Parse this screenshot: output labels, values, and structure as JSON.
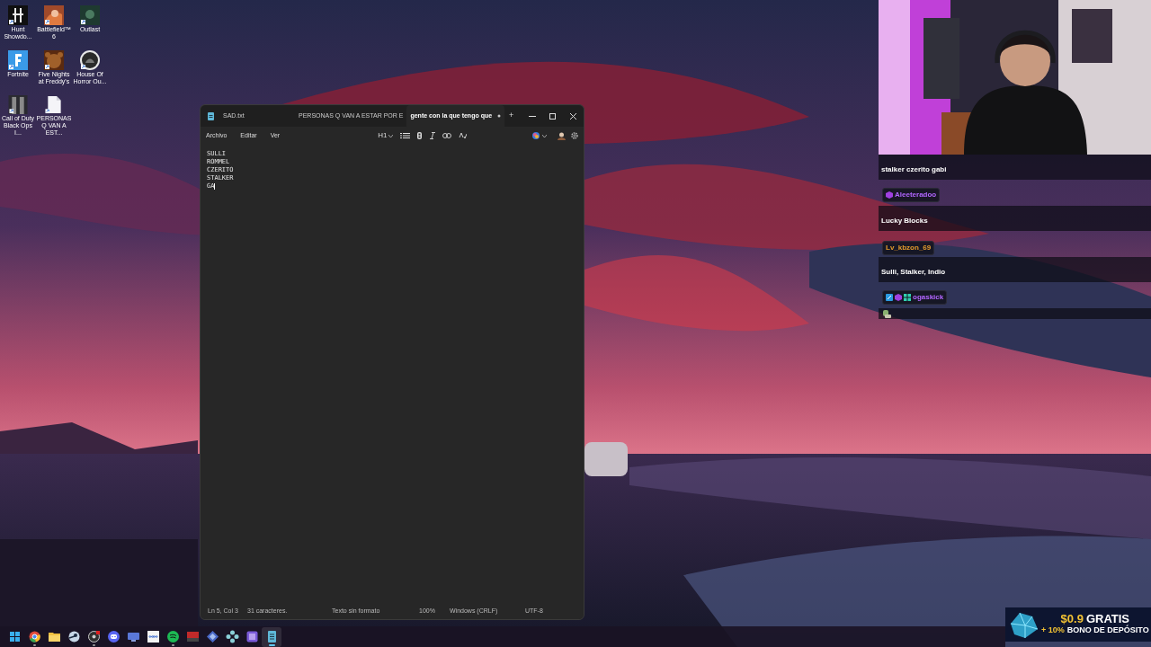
{
  "desktop_icons": [
    {
      "label": "Hunt Showdo...",
      "kind": "hunt"
    },
    {
      "label": "Battlefield™ 6",
      "kind": "battlefield"
    },
    {
      "label": "Outlast",
      "kind": "outlast"
    },
    {
      "label": "Fortnite",
      "kind": "fortnite"
    },
    {
      "label": "Five Nights at Freddy's",
      "kind": "fnaf"
    },
    {
      "label": "House Of Horror Ou...",
      "kind": "horror"
    },
    {
      "label": "Call of Duty Black Ops I...",
      "kind": "cod"
    },
    {
      "label": "PERSONAS Q VAN A EST...",
      "kind": "file"
    }
  ],
  "notepad": {
    "tabs": [
      {
        "title": "SAD.txt",
        "selected": false,
        "modified": false
      },
      {
        "title": "PERSONAS Q VAN A ESTAR POR E",
        "selected": false,
        "modified": false
      },
      {
        "title": "gente con la que tengo que",
        "selected": true,
        "modified": true
      }
    ],
    "new_tab": "+",
    "menu": [
      "Archivo",
      "Editar",
      "Ver"
    ],
    "heading_button": "H1",
    "lines": [
      "SULLI",
      "ROMMEL",
      "CZERITO",
      "STALKER",
      "GA"
    ],
    "status_bar": [
      "Ln 5, Col 3",
      "31 caracteres.",
      "Texto sin formato",
      "100%",
      "Windows (CRLF)",
      "UTF-8"
    ]
  },
  "chat": [
    {
      "kind": "message",
      "text": "stalker czerito gabi"
    },
    {
      "kind": "name_gem",
      "text": "Aleeteradoo",
      "color": "#b266ff"
    },
    {
      "kind": "message",
      "text": "Lucky Blocks"
    },
    {
      "kind": "name",
      "text": "Lv_kbzon_69",
      "color": "#e39a2c"
    },
    {
      "kind": "message",
      "text": "Sulli, Stalker, Indio"
    },
    {
      "kind": "name_multi",
      "text": "ogaskick",
      "color": "#b266ff"
    },
    {
      "kind": "emote"
    }
  ],
  "ad": {
    "price": "$0.9",
    "free": "GRATIS",
    "percent": "+ 10%",
    "bonus": "BONO DE DEPÓSITO"
  },
  "taskbar": [
    {
      "kind": "start",
      "running": false,
      "selected": false
    },
    {
      "kind": "chrome",
      "running": true,
      "selected": false
    },
    {
      "kind": "folder",
      "running": false,
      "selected": false
    },
    {
      "kind": "steam",
      "running": false,
      "selected": false
    },
    {
      "kind": "obs",
      "running": true,
      "selected": false
    },
    {
      "kind": "discord",
      "running": false,
      "selected": false
    },
    {
      "kind": "monitor",
      "running": false,
      "selected": false
    },
    {
      "kind": "infinity",
      "running": false,
      "selected": false
    },
    {
      "kind": "spotify",
      "running": true,
      "selected": false
    },
    {
      "kind": "redapp",
      "running": false,
      "selected": false
    },
    {
      "kind": "diamond",
      "running": false,
      "selected": false
    },
    {
      "kind": "gamepad",
      "running": false,
      "selected": false
    },
    {
      "kind": "purple",
      "running": false,
      "selected": false
    },
    {
      "kind": "notepad",
      "running": true,
      "selected": true
    }
  ]
}
